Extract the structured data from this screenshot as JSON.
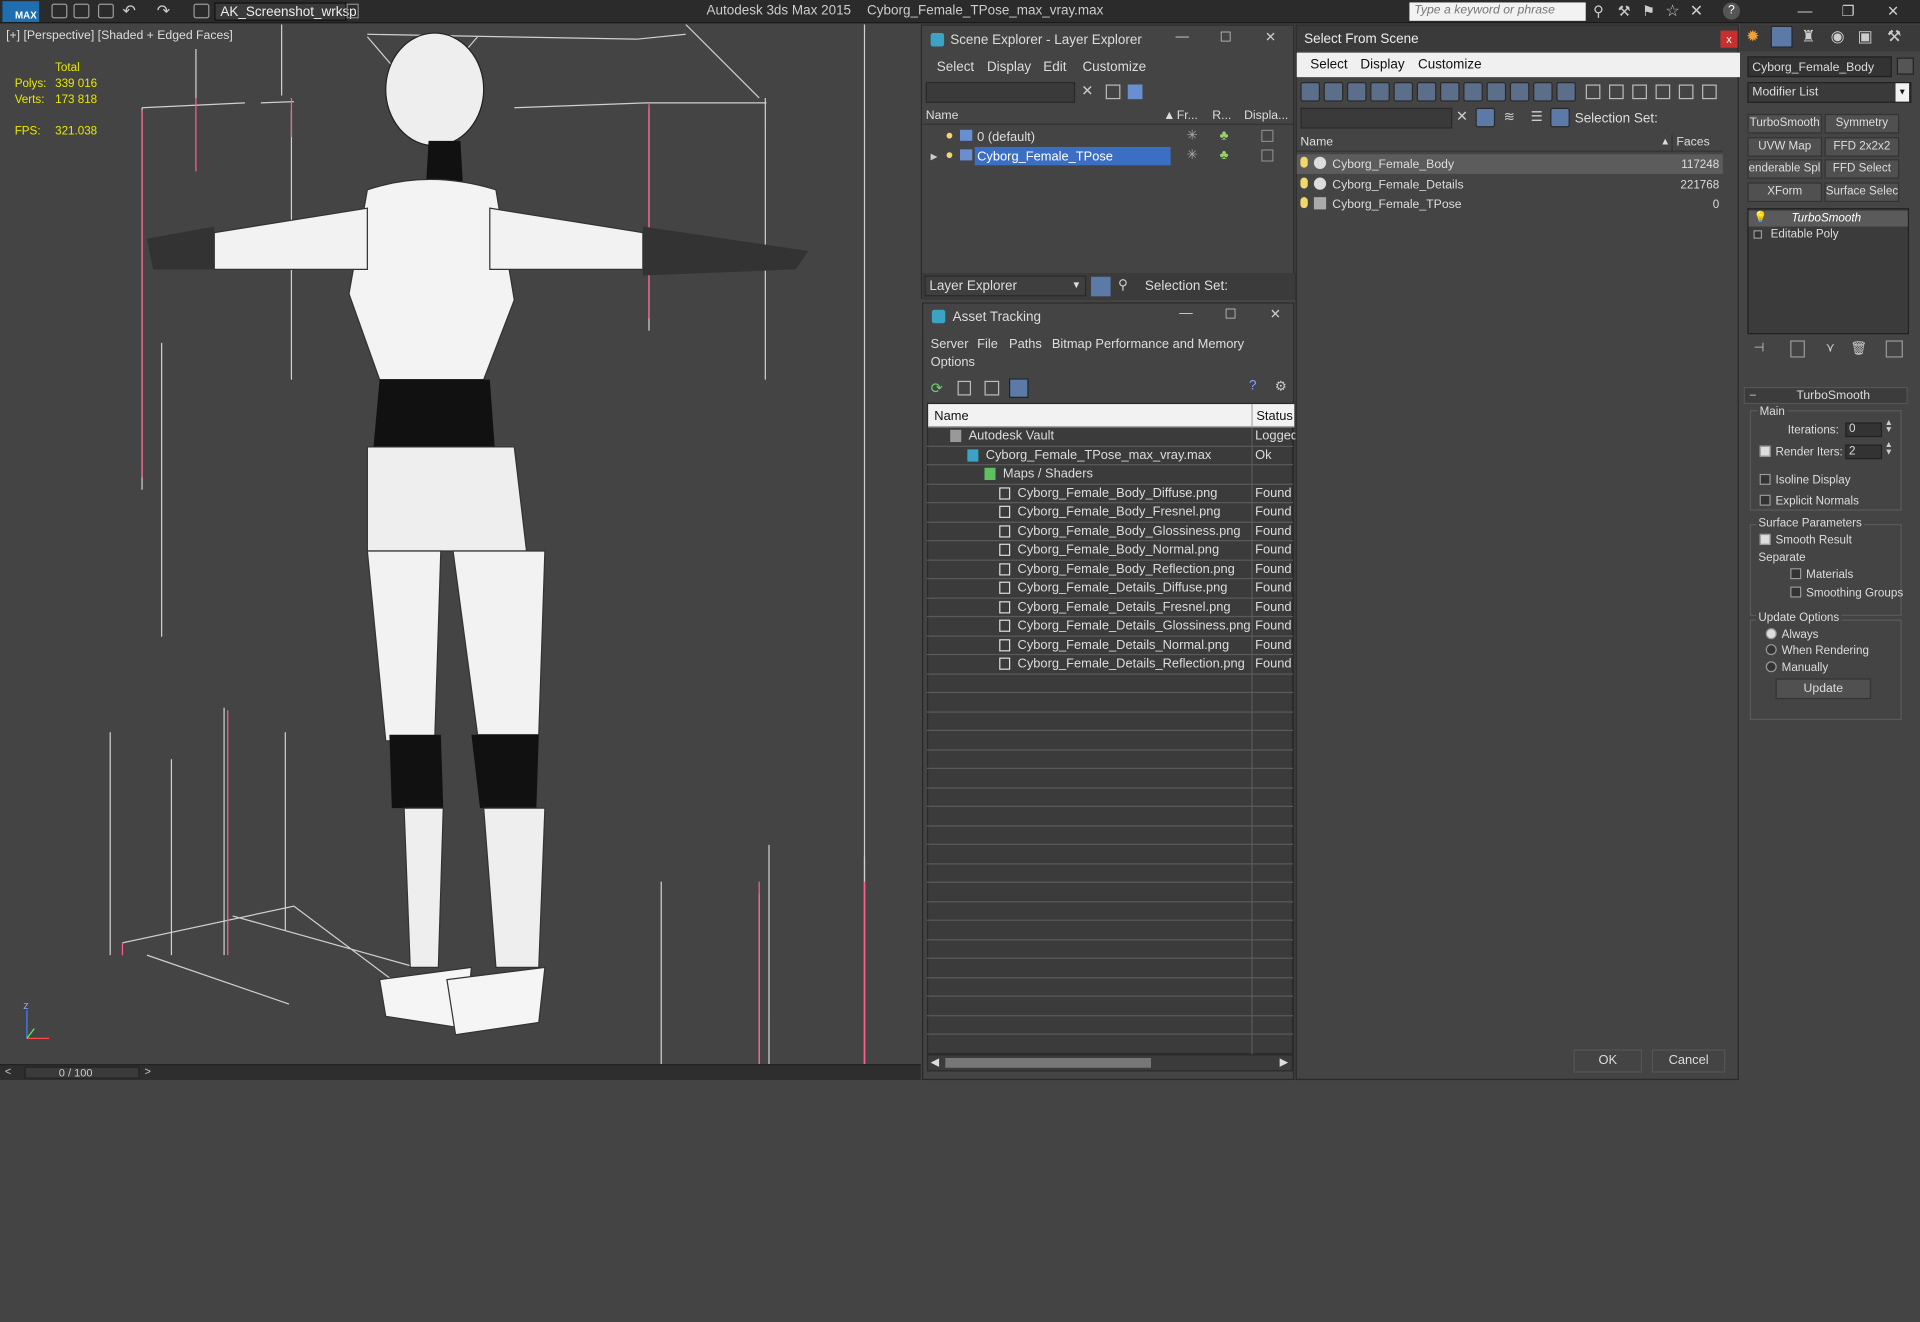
{
  "titlebar": {
    "workspace": "AK_Screenshot_wrksp",
    "app_title": "Autodesk 3ds Max  2015",
    "file_title": "Cyborg_Female_TPose_max_vray.max",
    "search_placeholder": "Type a keyword or phrase",
    "max_logo": "MAX"
  },
  "viewport": {
    "label": "[+] [Perspective] [Shaded + Edged Faces]",
    "stats": {
      "total_label": "Total",
      "polys_label": "Polys:",
      "polys_value": "339 016",
      "verts_label": "Verts:",
      "verts_value": "173 818",
      "fps_label": "FPS:",
      "fps_value": "321.038"
    },
    "time": "0 / 100",
    "axis_z": "z"
  },
  "scene_explorer": {
    "title": "Scene Explorer - Layer Explorer",
    "menus": [
      "Select",
      "Display",
      "Edit",
      "Customize"
    ],
    "columns": [
      "Name",
      "Fr...",
      "R...",
      "Displa..."
    ],
    "rows": [
      {
        "name": "0 (default)",
        "selected": false
      },
      {
        "name": "Cyborg_Female_TPose",
        "selected": true
      }
    ],
    "footer_label": "Layer Explorer",
    "selection_set": "Selection Set:"
  },
  "asset_tracking": {
    "title": "Asset Tracking",
    "menus": [
      "Server",
      "File",
      "Paths",
      "Bitmap Performance and Memory",
      "Options"
    ],
    "columns": [
      "Name",
      "Status"
    ],
    "rows": [
      {
        "name": "Autodesk Vault",
        "status": "Logged",
        "level": 0
      },
      {
        "name": "Cyborg_Female_TPose_max_vray.max",
        "status": "Ok",
        "level": 1
      },
      {
        "name": "Maps / Shaders",
        "status": "",
        "level": 2
      },
      {
        "name": "Cyborg_Female_Body_Diffuse.png",
        "status": "Found",
        "level": 3
      },
      {
        "name": "Cyborg_Female_Body_Fresnel.png",
        "status": "Found",
        "level": 3
      },
      {
        "name": "Cyborg_Female_Body_Glossiness.png",
        "status": "Found",
        "level": 3
      },
      {
        "name": "Cyborg_Female_Body_Normal.png",
        "status": "Found",
        "level": 3
      },
      {
        "name": "Cyborg_Female_Body_Reflection.png",
        "status": "Found",
        "level": 3
      },
      {
        "name": "Cyborg_Female_Details_Diffuse.png",
        "status": "Found",
        "level": 3
      },
      {
        "name": "Cyborg_Female_Details_Fresnel.png",
        "status": "Found",
        "level": 3
      },
      {
        "name": "Cyborg_Female_Details_Glossiness.png",
        "status": "Found",
        "level": 3
      },
      {
        "name": "Cyborg_Female_Details_Normal.png",
        "status": "Found",
        "level": 3
      },
      {
        "name": "Cyborg_Female_Details_Reflection.png",
        "status": "Found",
        "level": 3
      }
    ]
  },
  "select_from_scene": {
    "title": "Select From Scene",
    "menus": [
      "Select",
      "Display",
      "Customize"
    ],
    "selection_set": "Selection Set:",
    "columns": [
      "Name",
      "Faces"
    ],
    "rows": [
      {
        "name": "Cyborg_Female_Body",
        "faces": "117248",
        "selected": true
      },
      {
        "name": "Cyborg_Female_Details",
        "faces": "221768",
        "selected": false
      },
      {
        "name": "Cyborg_Female_TPose",
        "faces": "0",
        "selected": false
      }
    ],
    "ok": "OK",
    "cancel": "Cancel"
  },
  "command_panel": {
    "object_name": "Cyborg_Female_Body",
    "modifier_list": "Modifier List",
    "modifier_buttons": [
      "TurboSmooth",
      "Symmetry",
      "UVW Map",
      "FFD 2x2x2",
      "enderable Spli",
      "FFD Select",
      "XForm",
      "Surface Select"
    ],
    "stack": [
      "TurboSmooth",
      "Editable Poly"
    ],
    "rollout_title": "TurboSmooth",
    "main_label": "Main",
    "iterations_label": "Iterations:",
    "iterations_value": "0",
    "render_iters_label": "Render Iters:",
    "render_iters_value": "2",
    "isoline_display": "Isoline Display",
    "explicit_normals": "Explicit Normals",
    "surface_params": "Surface Parameters",
    "smooth_result": "Smooth Result",
    "separate": "Separate",
    "materials": "Materials",
    "smoothing_groups": "Smoothing Groups",
    "update_options": "Update Options",
    "always": "Always",
    "when_rendering": "When Rendering",
    "manually": "Manually",
    "update_btn": "Update"
  },
  "colors": {
    "accent_blue": "#2f5f9e",
    "selection_blue": "#3a6fc4",
    "stat_yellow": "#e8e800",
    "close_red": "#c83030"
  }
}
